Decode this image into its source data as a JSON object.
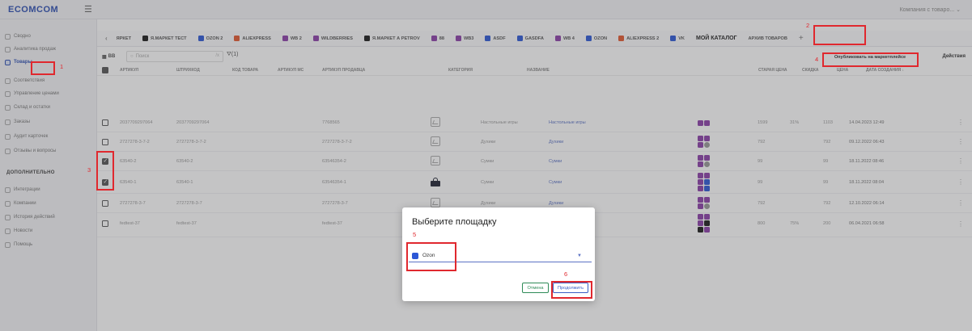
{
  "app": {
    "logo": "ECOMCOM",
    "burger_icon": "☰",
    "company": "Компания с товаро... ⌄"
  },
  "sidebar": {
    "items": [
      {
        "label": "Сводно"
      },
      {
        "label": "Аналитика продаж"
      },
      {
        "label": "Товары",
        "active": true
      },
      {
        "label": "Соответствия"
      },
      {
        "label": "Управление ценами"
      },
      {
        "label": "Склад и остатки"
      },
      {
        "label": "Заказы"
      },
      {
        "label": "Аудит карточек"
      },
      {
        "label": "Отзывы и вопросы"
      }
    ],
    "section_title": "ДОПОЛНИТЕЛЬНО",
    "extra_items": [
      {
        "label": "Интеграции"
      },
      {
        "label": "Компании"
      },
      {
        "label": "История действий"
      },
      {
        "label": "Новости"
      },
      {
        "label": "Помощь"
      }
    ]
  },
  "tabs": {
    "back_arrow": "‹",
    "items": [
      {
        "label": "ЯРКЕТ",
        "color": ""
      },
      {
        "label": "Я.МАРКЕТ ТЕСТ",
        "color": "#1a1a1a"
      },
      {
        "label": "OZON 2",
        "color": "#2c57d6"
      },
      {
        "label": "ALIEXPRESS",
        "color": "#e4572e"
      },
      {
        "label": "WB 2",
        "color": "#8b3fa8"
      },
      {
        "label": "WILDBERRIES",
        "color": "#8b3fa8"
      },
      {
        "label": "Я.МАРКЕТ А PETROV",
        "color": "#1a1a1a"
      },
      {
        "label": "88",
        "color": "#8b3fa8"
      },
      {
        "label": "WB3",
        "color": "#8b3fa8"
      },
      {
        "label": "ASDF",
        "color": "#2c57d6"
      },
      {
        "label": "GASDFA",
        "color": "#2c57d6"
      },
      {
        "label": "WB 4",
        "color": "#8b3fa8"
      },
      {
        "label": "OZON",
        "color": "#2c57d6"
      },
      {
        "label": "ALIEXPRESS 2",
        "color": "#e4572e"
      },
      {
        "label": "VK",
        "color": "#2c57d6"
      }
    ],
    "catalog": "МОЙ КАТАЛОГ",
    "archive": "АРХИВ ТОВАРОВ",
    "plus": "+"
  },
  "toolbar": {
    "view_label": "ВВ",
    "search_placeholder": "Поиск",
    "search_clear": "/х",
    "filter_label": "(1)",
    "publish_label": "Опубликовать на маркетплейсе",
    "actions_label": "Действия"
  },
  "table": {
    "headers": {
      "article": "АРТИКУЛ",
      "barcode": "ШТРИХКОД",
      "code": "КОД ТОВАРА",
      "article_mp": "АРТИКУЛ МС",
      "seller_article": "АРТИКУЛ ПРОДАВЦА",
      "category": "КАТЕГОРИЯ",
      "name": "НАЗВАНИЕ",
      "old_price": "СТАРАЯ ЦЕНА",
      "discount": "СКИДКА",
      "price": "ЦЕНА",
      "created": "ДАТА СОЗДАНИЯ ↓"
    },
    "rows": [
      {
        "article": "2037709297064",
        "barcode": "2037709297064",
        "seller_article": "7768565",
        "category": "Настольные игры",
        "name": "Настольные игры",
        "old_price": "1599",
        "discount": "31%",
        "price": "1103",
        "created": "14.04.2023 12:49",
        "checked": false
      },
      {
        "article": "2727278-3-7-2",
        "barcode": "2727278-3-7-2",
        "seller_article": "2727278-3-7-2",
        "category": "Духики",
        "name": "Духики",
        "old_price": "792",
        "discount": "",
        "price": "792",
        "created": "09.12.2022 06:43",
        "checked": false
      },
      {
        "article": "63540-2",
        "barcode": "63540-2",
        "seller_article": "63546354-2",
        "category": "Сумки",
        "name": "Сумки",
        "old_price": "99",
        "discount": "",
        "price": "99",
        "created": "18.11.2022 08:46",
        "checked": true
      },
      {
        "article": "63540-1",
        "barcode": "63540-1",
        "seller_article": "63546354-1",
        "category": "Сумки",
        "name": "Сумки",
        "old_price": "99",
        "discount": "",
        "price": "99",
        "created": "18.11.2022 08:04",
        "checked": true
      },
      {
        "article": "2727278-3-7",
        "barcode": "2727278-3-7",
        "seller_article": "2727278-3-7",
        "category": "Духики",
        "name": "Духики",
        "old_price": "792",
        "discount": "",
        "price": "792",
        "created": "12.10.2022 06:14",
        "checked": false
      },
      {
        "article": "fedtest-37",
        "barcode": "fedtest-37",
        "seller_article": "fedtest-37",
        "category": "",
        "name": "",
        "old_price": "800",
        "discount": "75%",
        "price": "200",
        "created": "06.04.2021 06:58",
        "checked": false
      }
    ]
  },
  "dialog": {
    "title": "Выберите площадку",
    "selected": "Ozon",
    "caret": "▼",
    "cancel": "Отмена",
    "continue": "Продолжить"
  },
  "annotations": [
    "1",
    "2",
    "3",
    "4",
    "5",
    "6"
  ],
  "colors": {
    "brand": "#2d4fb3",
    "highlight": "#e0282e",
    "ozon": "#2c57d6",
    "wb": "#8b3fa8"
  }
}
